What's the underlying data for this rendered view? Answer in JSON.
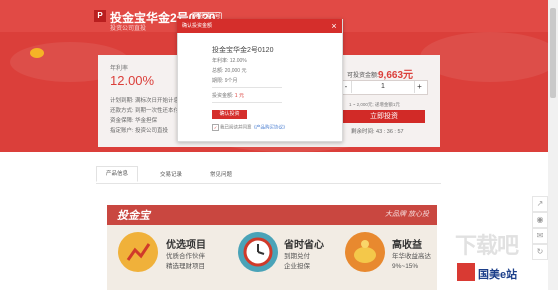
{
  "header": {
    "logo": "P",
    "title": "投金宝华金2号0120",
    "tag": "网投宝2号",
    "subtitle": "投资公司直投"
  },
  "product": {
    "rate_label": "年利率",
    "rate": "12.00%",
    "rows": [
      "计划到期:  满标次日开始计息",
      "还款方式:  到期一次性还本付息",
      "资金保障:  华金担保",
      "指定账户:  投资公司直投"
    ]
  },
  "invest": {
    "amount_label": "可投资金额:",
    "amount": "9,663元",
    "stepper_minus": "-",
    "stepper_value": "1",
    "stepper_plus": "+",
    "hint": "1 ~ 2,000元; 递增金额1元",
    "button": "立即投资",
    "countdown": "剩余时间: 43 : 36 : 57"
  },
  "tabs": [
    "产品信息",
    "交易记录",
    "常见问题"
  ],
  "banner": {
    "title": "投金宝",
    "slogan": "大品牌 放心投",
    "features": [
      {
        "title": "优选项目",
        "line1": "优质合作伙伴",
        "line2": "精选理财项目",
        "icon": "chart-icon"
      },
      {
        "title": "省时省心",
        "line1": "到期兑付",
        "line2": "企业担保",
        "icon": "clock-icon"
      },
      {
        "title": "高收益",
        "line1": "年华收益高达",
        "line2": "9%~15%",
        "icon": "piggy-bank-icon"
      }
    ]
  },
  "modal": {
    "header": "确认投资金额",
    "close": "×",
    "product_name": "投金宝华金2号0120",
    "rows": [
      "年利率:  12.00%",
      "总额:  20,000 元",
      "期限:  9个月"
    ],
    "invest_label": "投资金额:",
    "invest_value": "1 元",
    "confirm": "确认投资",
    "agree": "我已阅读并同意",
    "agree_link": "《产品购买协议》"
  },
  "watermark": {
    "big": "下载吧",
    "brand": "国美e站"
  },
  "colors": {
    "accent": "#d52e2b",
    "header": "#e14a45",
    "panel": "#f5f1f0"
  }
}
